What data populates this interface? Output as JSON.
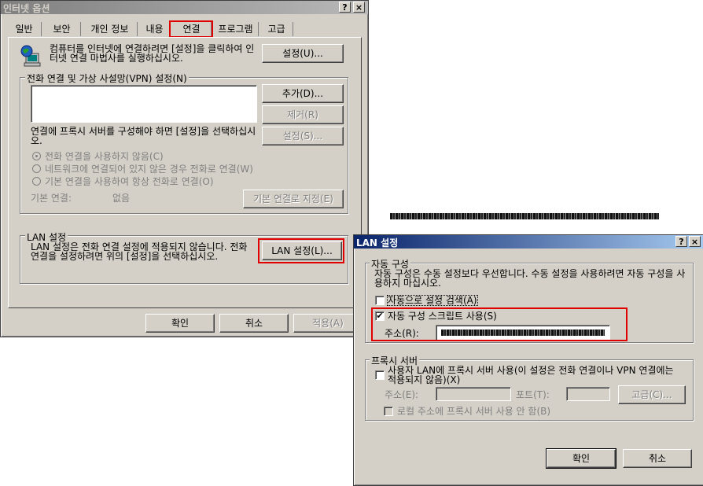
{
  "internet_options": {
    "title": "인터넷 옵션",
    "help": "?",
    "close": "×",
    "tabs": [
      "일반",
      "보안",
      "개인 정보",
      "내용",
      "연결",
      "프로그램",
      "고급"
    ],
    "setup_text": "컴퓨터를 인터넷에 연결하려면 [설정]을 클릭하여 인터넷 연결 마법사를 실행하십시오.",
    "setup_button": "설정(U)...",
    "dialup_legend": "전화 연결 및 가상 사설망(VPN) 설정(N)",
    "add_button": "추가(D)...",
    "remove_button": "제거(R)",
    "settings_button": "설정(S)...",
    "proxy_note": "연결에 프록시 서버를 구성해야 하면 [설정]을 선택하십시오.",
    "radio_options": [
      "전화 연결을 사용하지 않음(C)",
      "네트워크에 연결되어 있지 않은 경우 전화로 연결(W)",
      "기본 연결을 사용하여 항상 전화로 연결(O)"
    ],
    "default_label": "기본 연결:",
    "default_value": "없음",
    "set_default_button": "기본 연결로 지정(E)",
    "lan_legend": "LAN 설정",
    "lan_text": "LAN 설정은 전화 연결 설정에 적용되지 않습니다. 전화 연결을 설정하려면 위의 [설정]을 선택하십시오.",
    "lan_button": "LAN 설정(L)...",
    "ok": "확인",
    "cancel": "취소",
    "apply": "적용(A)"
  },
  "lan_settings": {
    "title": "LAN 설정",
    "help": "?",
    "close": "×",
    "auto_legend": "자동 구성",
    "auto_text": "자동 구성은 수동 설정보다 우선합니다. 수동 설정을 사용하려면 자동 구성을 사용하지 마십시오.",
    "auto_detect": "자동으로 설정 검색(A)",
    "auto_script": "자동 구성 스크립트 사용(S)",
    "address_label": "주소(R):",
    "proxy_legend": "프록시 서버",
    "proxy_use": "사용자 LAN에 프록시 서버 사용(이 설정은 전화 연결이나 VPN 연결에는 적용되지 않음)(X)",
    "proxy_address_label": "주소(E):",
    "port_label": "포트(T):",
    "advanced_button": "고급(C)...",
    "bypass_local": "로컬 주소에 프록시 서버 사용 안 함(B)",
    "ok": "확인",
    "cancel": "취소",
    "auto_script_checked": true,
    "auto_detect_checked": false
  },
  "colors": {
    "highlight": "#e00000",
    "face": "#d4d0c8",
    "active_title": "#0a246a"
  }
}
